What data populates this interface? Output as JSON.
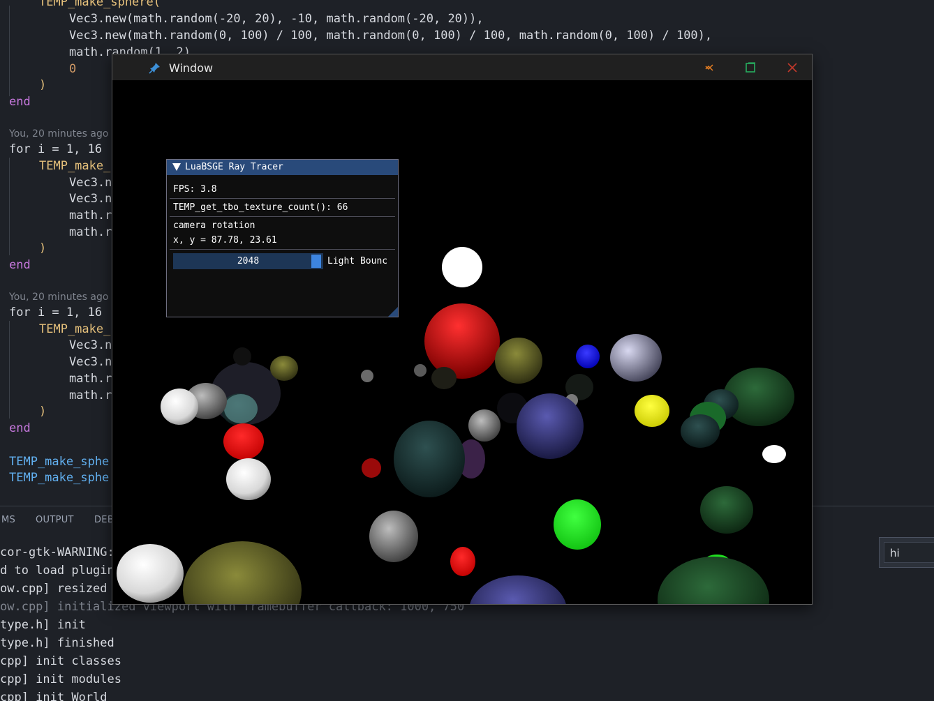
{
  "editor": {
    "lines": [
      {
        "text": "TEMP_make_sphere("
      },
      {
        "text": "Vec3.new(math.random(-20, 20), -10, math.random(-20, 20)),"
      },
      {
        "text": "Vec3.new(math.random(0, 100) / 100, math.random(0, 100) / 100, math.random(0, 100) / 100),"
      },
      {
        "text": "math.random(1, 2),"
      },
      {
        "text": "0"
      },
      {
        "text": ")"
      },
      {
        "text": "end"
      },
      {
        "text": "for i = 1, 16"
      },
      {
        "text": "TEMP_make_"
      },
      {
        "text": "Vec3.n"
      },
      {
        "text": "Vec3.n"
      },
      {
        "text": "math.r"
      },
      {
        "text": "math.r"
      },
      {
        "text": ")"
      },
      {
        "text": "end"
      },
      {
        "text": "for i = 1, 16"
      },
      {
        "text": "TEMP_make_"
      },
      {
        "text": "Vec3.n"
      },
      {
        "text": "Vec3.n"
      },
      {
        "text": "math.r"
      },
      {
        "text": "math.r"
      },
      {
        "text": ")"
      },
      {
        "text": "end"
      },
      {
        "text": "TEMP_make_sphe"
      },
      {
        "text": "TEMP_make_sphe"
      }
    ],
    "blame_1": "You, 20 minutes ago",
    "blame_2": "You, 20 minutes ago"
  },
  "panel": {
    "tabs": [
      "MS",
      "OUTPUT",
      "DEB"
    ],
    "terminal_lines": [
      "cor-gtk-WARNING:",
      "d to load plugin",
      "ow.cpp] resized",
      "ow.cpp] initialized viewport with framebuffer callback: 1000, 750",
      "type.h] init",
      "type.h] finished",
      "cpp] init classes",
      "cpp] init modules",
      "cpp] init World"
    ]
  },
  "hi_input": {
    "value": "hi"
  },
  "window": {
    "title": "Window",
    "pin_icon": "pin-icon",
    "minimize_icon": "minimize-icon",
    "maximize_icon": "maximize-icon",
    "close_icon": "close-icon",
    "accent_minimize": "#e67e22",
    "accent_maximize": "#27ae60",
    "accent_close": "#c0392b"
  },
  "imgui": {
    "title": "LuaBSGE Ray Tracer",
    "fps": "FPS: 3.8",
    "texture_count": "TEMP_get_tbo_texture_count(): 66",
    "camera_label": "camera rotation",
    "camera_values": "x, y = 87.78, 23.61",
    "slider_value": "2048",
    "slider_label": "Light Bounc",
    "header_color": "#294a7a",
    "grab_color": "#3d85e0"
  }
}
